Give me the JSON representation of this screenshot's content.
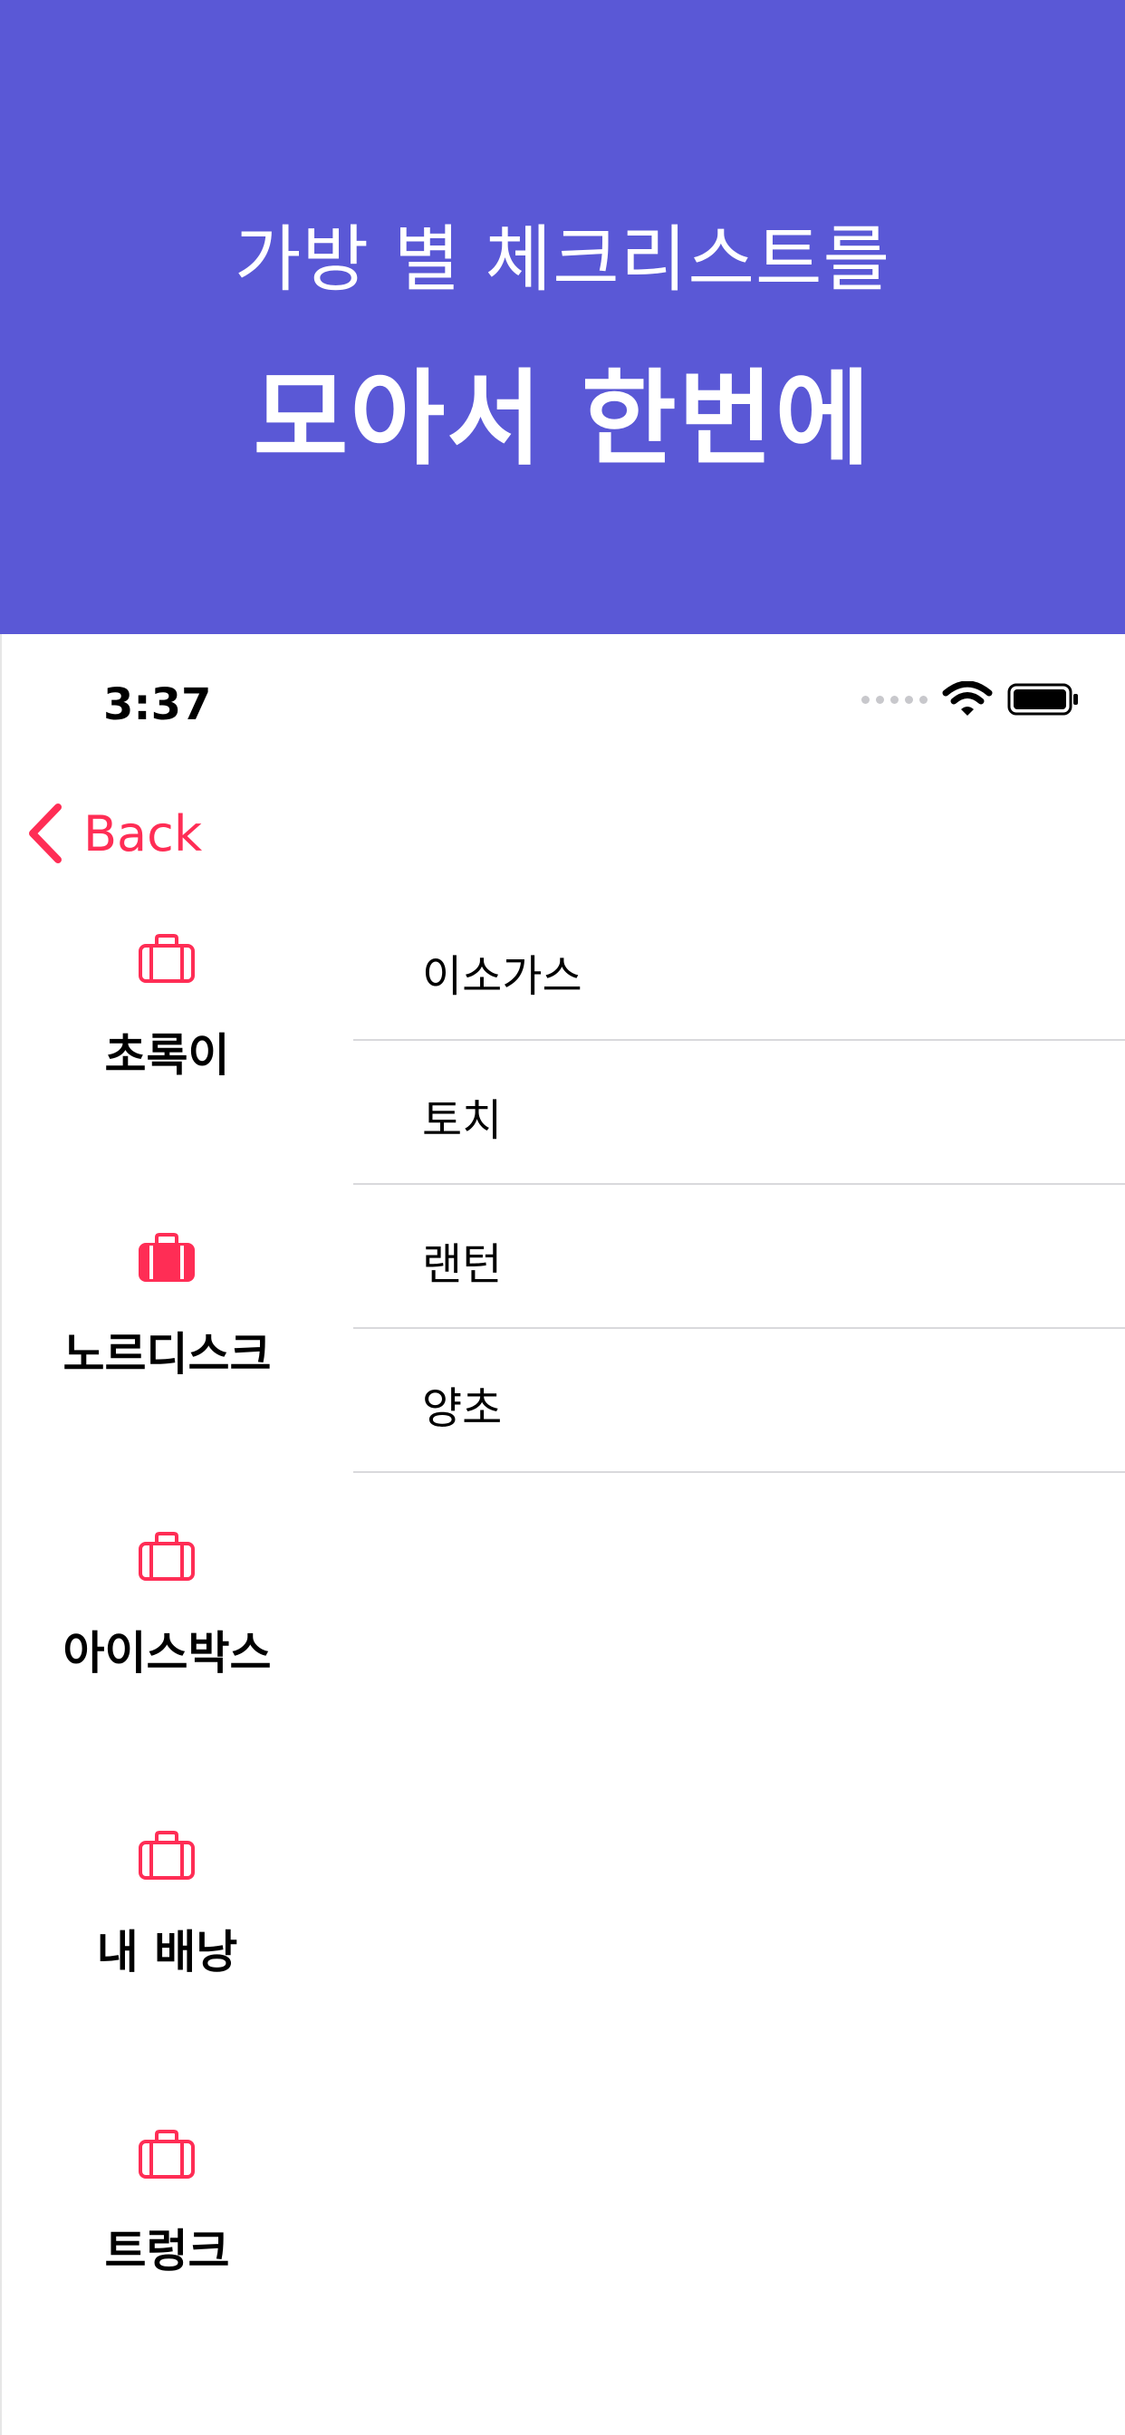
{
  "banner": {
    "subtitle": "가방 별 체크리스트를",
    "title": "모아서 한번에",
    "background_color": "#5a58d6"
  },
  "status_bar": {
    "time": "3:37",
    "icons": [
      "cellular-dots-icon",
      "wifi-icon",
      "battery-icon"
    ]
  },
  "nav": {
    "back_label": "Back",
    "accent_color": "#ff2d55"
  },
  "bags": [
    {
      "label": "초록이",
      "icon": "briefcase-outline-icon",
      "selected": false
    },
    {
      "label": "노르디스크",
      "icon": "briefcase-filled-icon",
      "selected": true
    },
    {
      "label": "아이스박스",
      "icon": "briefcase-outline-icon",
      "selected": false
    },
    {
      "label": "내 배낭",
      "icon": "briefcase-outline-icon",
      "selected": false
    },
    {
      "label": "트렁크",
      "icon": "briefcase-outline-icon",
      "selected": false
    }
  ],
  "items": [
    {
      "label": "이소가스"
    },
    {
      "label": "토치"
    },
    {
      "label": "랜턴"
    },
    {
      "label": "양초"
    }
  ]
}
